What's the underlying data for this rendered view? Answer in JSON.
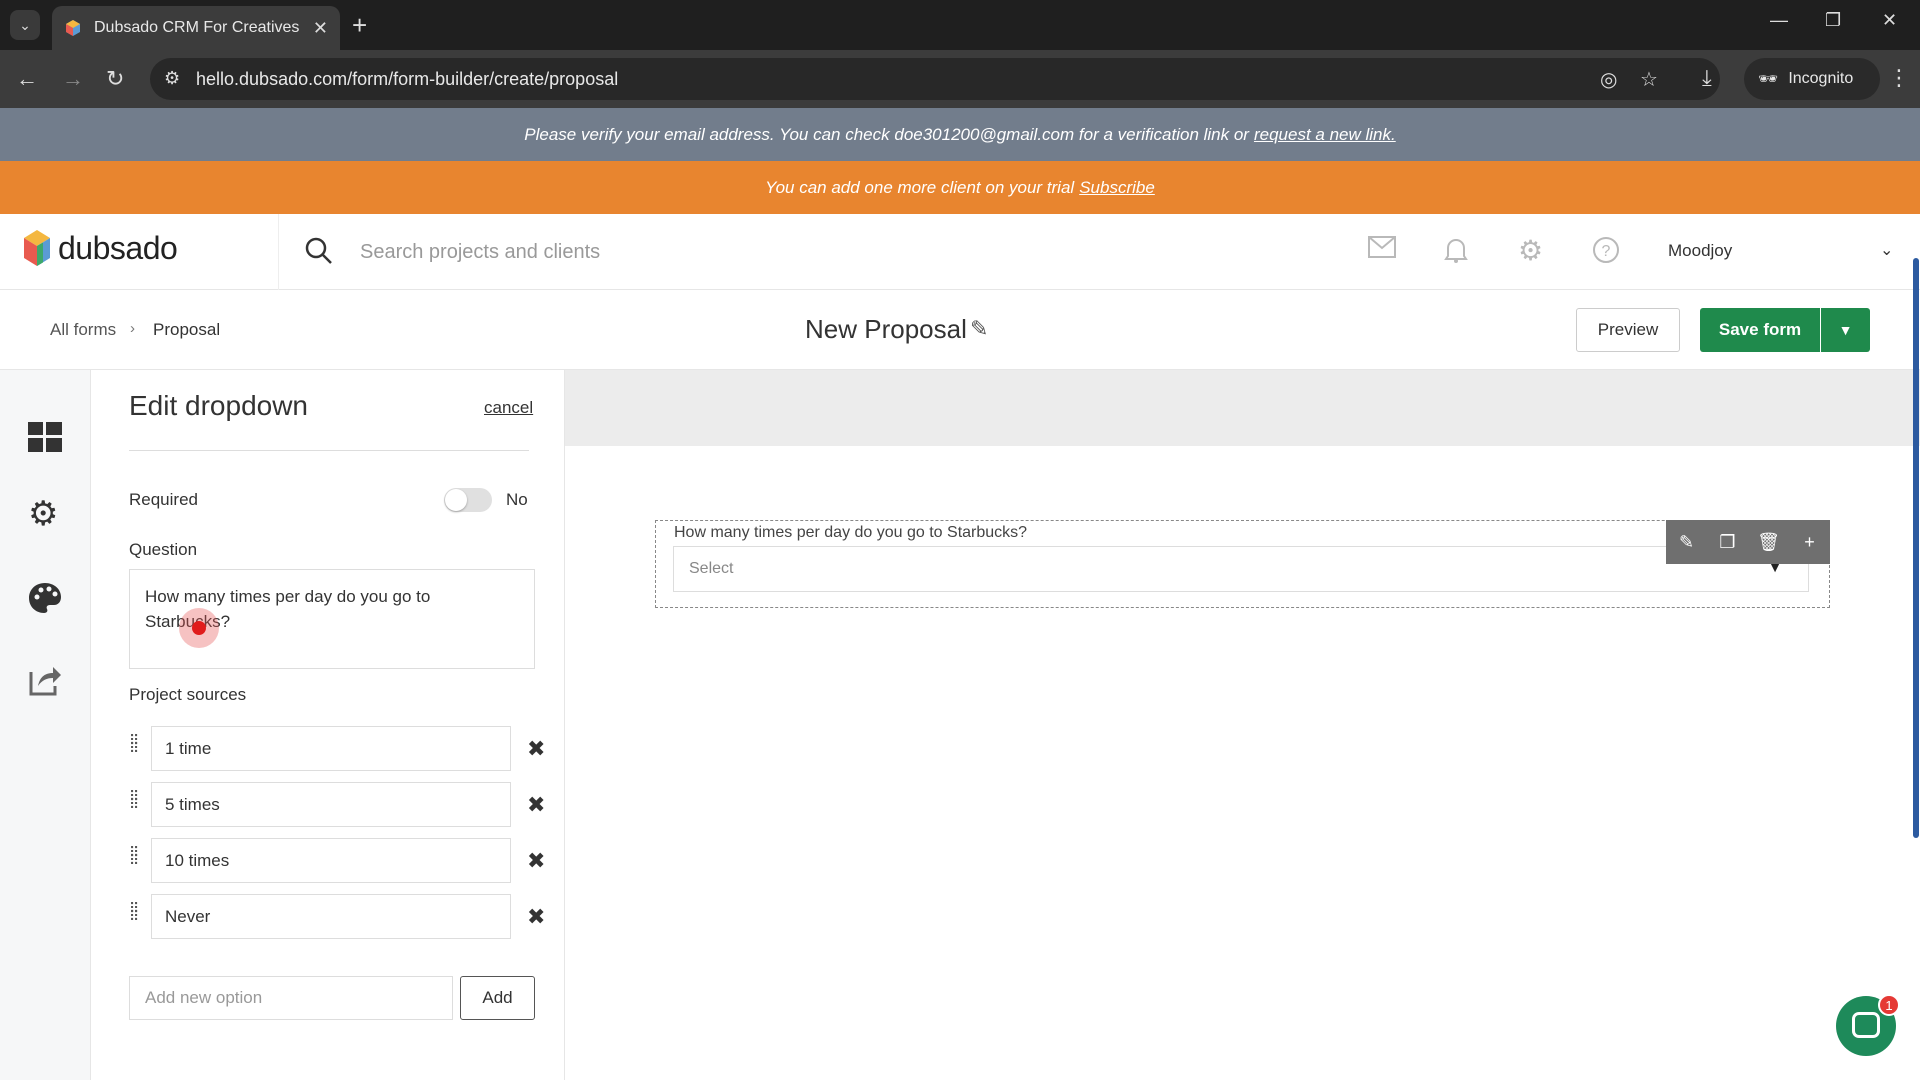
{
  "browser": {
    "tab_title": "Dubsado CRM For Creatives",
    "url": "hello.dubsado.com/form/form-builder/create/proposal",
    "incognito_label": "Incognito"
  },
  "banners": {
    "verify_text": "Please verify your email address. You can check doe301200@gmail.com for a verification link or",
    "verify_link": "request a new link.",
    "trial_text": "You can add one more client on your trial",
    "trial_link": "Subscribe",
    "verify_bg": "#727d8c",
    "trial_bg": "#e8852f"
  },
  "header": {
    "logo_text": "dubsado",
    "search_placeholder": "Search projects and clients",
    "user_name": "Moodjoy",
    "icons": [
      "mail-icon",
      "bell-icon",
      "gear-icon",
      "help-icon"
    ]
  },
  "subheader": {
    "breadcrumb_all": "All forms",
    "breadcrumb_sep": "›",
    "breadcrumb_current": "Proposal",
    "form_title": "New Proposal",
    "preview_label": "Preview",
    "save_label": "Save form",
    "accent": "#1f8a4c"
  },
  "panel": {
    "title": "Edit dropdown",
    "cancel_label": "cancel",
    "required_label": "Required",
    "required_value": "No",
    "required_on": false,
    "question_label": "Question",
    "question_text": "How many times per day do you go to Starbucks?",
    "sources_label": "Project sources",
    "options": [
      "1 time",
      "5 times",
      "10 times",
      "Never"
    ],
    "new_option_placeholder": "Add new option",
    "add_label": "Add"
  },
  "canvas": {
    "question": "How many times per day do you go to Starbucks?",
    "select_placeholder": "Select"
  },
  "chat": {
    "badge_count": "1"
  }
}
